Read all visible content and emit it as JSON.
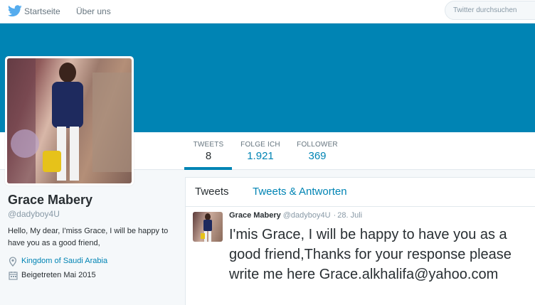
{
  "nav": {
    "home_label": "Startseite",
    "about_label": "Über uns",
    "search_placeholder": "Twitter durchsuchen"
  },
  "stats": [
    {
      "label": "TWEETS",
      "value": "8"
    },
    {
      "label": "FOLGE ICH",
      "value": "1.921"
    },
    {
      "label": "FOLLOWER",
      "value": "369"
    }
  ],
  "profile": {
    "name": "Grace Mabery",
    "handle": "@dadyboy4U",
    "bio": "Hello, My dear, I'miss Grace, I will be happy to have you as a good friend,",
    "location": "Kingdom of Saudi Arabia",
    "joined": "Beigetreten Mai 2015"
  },
  "tabs": {
    "tweets": "Tweets",
    "replies": "Tweets & Antworten"
  },
  "tweet": {
    "name": "Grace Mabery",
    "handle": "@dadyboy4U",
    "separator": "·",
    "date": "28. Juli",
    "text": "I'mis Grace, I will be happy to have you as a good friend,Thanks for your response please write me here Grace.alkhalifa@yahoo.com"
  },
  "colors": {
    "accent": "#0084b4",
    "banner": "#0084b4",
    "background": "#f5f8fa"
  },
  "icons": {
    "logo": "twitter-bird-icon",
    "location": "location-pin-icon",
    "joined": "calendar-icon"
  }
}
